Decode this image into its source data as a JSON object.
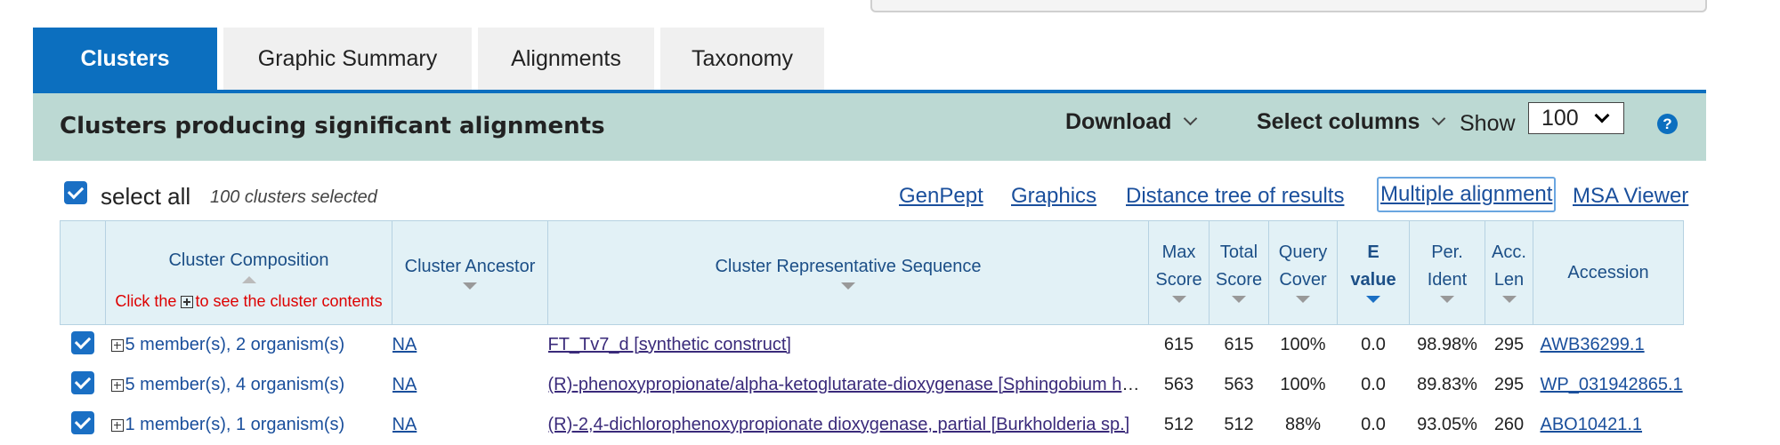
{
  "tabs": [
    {
      "label": "Clusters",
      "active": true
    },
    {
      "label": "Graphic Summary",
      "active": false
    },
    {
      "label": "Alignments",
      "active": false
    },
    {
      "label": "Taxonomy",
      "active": false
    }
  ],
  "header": {
    "title": "Clusters producing significant alignments",
    "download_label": "Download",
    "select_columns_label": "Select columns",
    "show_label": "Show",
    "show_value": "100",
    "help_icon": "?"
  },
  "toolbar": {
    "select_all_label": "select all",
    "selected_count": "100 clusters selected",
    "links": [
      "GenPept",
      "Graphics",
      "Distance tree of results",
      "Multiple alignment",
      "MSA Viewer"
    ]
  },
  "table": {
    "columns": {
      "composition": "Cluster Composition",
      "composition_hint_pre": "Click the",
      "composition_hint_post": "to see the cluster contents",
      "ancestor": "Cluster Ancestor",
      "representative": "Cluster Representative Sequence",
      "max_score_1": "Max",
      "max_score_2": "Score",
      "total_score_1": "Total",
      "total_score_2": "Score",
      "query_cover_1": "Query",
      "query_cover_2": "Cover",
      "evalue_1": "E",
      "evalue_2": "value",
      "per_ident_1": "Per.",
      "per_ident_2": "Ident",
      "acc_len_1": "Acc.",
      "acc_len_2": "Len",
      "accession": "Accession"
    },
    "rows": [
      {
        "composition": "5 member(s), 2 organism(s)",
        "ancestor": "NA",
        "description": "FT_Tv7_d [synthetic construct]",
        "max_score": "615",
        "total_score": "615",
        "query_cover": "100%",
        "evalue": "0.0",
        "per_ident": "98.98%",
        "acc_len": "295",
        "accession": "AWB36299.1"
      },
      {
        "composition": "5 member(s), 4 organism(s)",
        "ancestor": "NA",
        "description": "(R)-phenoxypropionate/alpha-ketoglutarate-dioxygenase [Sphingobium herbicidovorans]",
        "max_score": "563",
        "total_score": "563",
        "query_cover": "100%",
        "evalue": "0.0",
        "per_ident": "89.83%",
        "acc_len": "295",
        "accession": "WP_031942865.1"
      },
      {
        "composition": "1 member(s), 1 organism(s)",
        "ancestor": "NA",
        "description": "(R)-2,4-dichlorophenoxypropionate dioxygenase, partial [Burkholderia sp.]",
        "max_score": "512",
        "total_score": "512",
        "query_cover": "88%",
        "evalue": "0.0",
        "per_ident": "93.05%",
        "acc_len": "260",
        "accession": "ABO10421.1"
      }
    ]
  }
}
